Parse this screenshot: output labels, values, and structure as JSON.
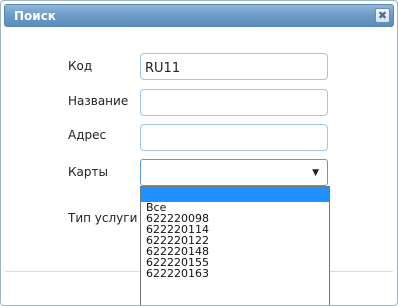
{
  "dialog": {
    "title": "Поиск",
    "close_glyph": "✖",
    "close_icon": "close-icon"
  },
  "form": {
    "code_label": "Код",
    "code_value": "RU11",
    "name_label": "Название",
    "name_value": "",
    "address_label": "Адрес",
    "address_value": "",
    "cards_label": "Карты",
    "cards_value": "",
    "service_label": "Тип услуги"
  },
  "dropdown": {
    "caret": "▼",
    "options": [
      "",
      "Все",
      "622220098",
      "622220114",
      "622220122",
      "622220148",
      "622220155",
      "622220163"
    ]
  },
  "colors": {
    "titlebar": "#6f9dc8",
    "highlight": "#1e90ff",
    "field_border": "#9fc6e6"
  }
}
